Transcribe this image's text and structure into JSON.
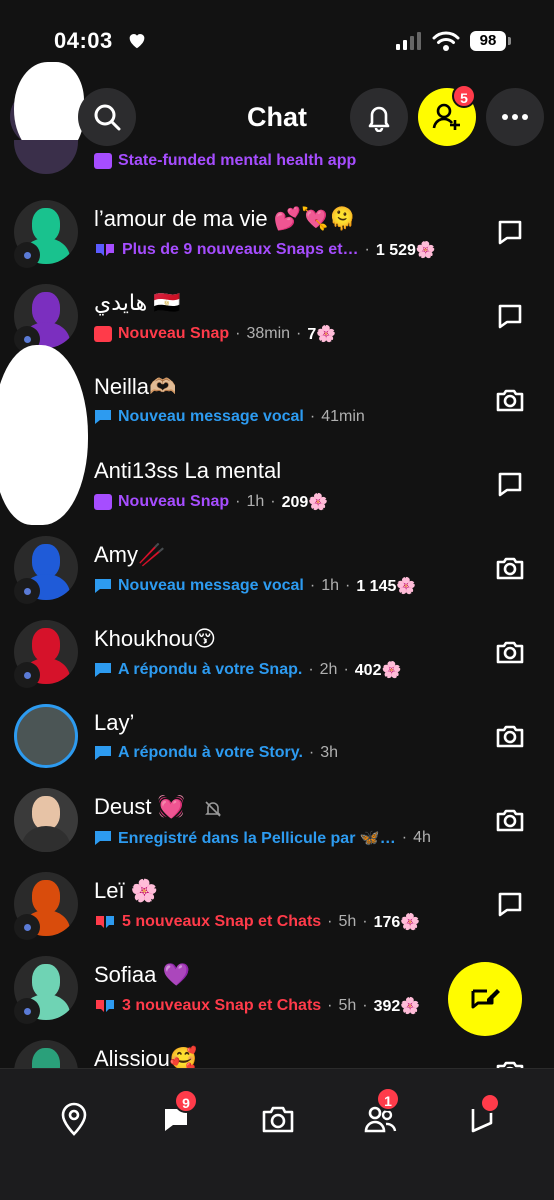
{
  "status": {
    "time": "04:03",
    "battery": "98"
  },
  "header": {
    "title": "Chat",
    "friend_badge": "5"
  },
  "chats": [
    {
      "name": "",
      "preview": "State-funded mental health app",
      "preview_color": "#a64dff",
      "meta": "",
      "streak": "",
      "action": "none",
      "avatar_color": "#5b3aa0"
    },
    {
      "name": "l’amour de ma vie 💕💘🫠",
      "preview": "Plus de 9 nouveaux Snaps et…",
      "preview_color": "#a64dff",
      "meta": "",
      "streak": "1 529🌸",
      "action": "chat",
      "avatar_color": "#19c28e"
    },
    {
      "name": "هايدي 🇪🇬",
      "preview": "Nouveau Snap",
      "preview_color": "#ff3b4a",
      "meta": "38min",
      "streak": "7🌸",
      "action": "chat",
      "avatar_color": "#7b2fbf"
    },
    {
      "name": "Neilla🫶🏼",
      "preview": "Nouveau message vocal",
      "preview_color": "#2d9bf0",
      "meta": "41min",
      "streak": "",
      "action": "camera",
      "avatar_color": "#444444"
    },
    {
      "name": "Anti13ss La mental",
      "preview": "Nouveau Snap",
      "preview_color": "#a64dff",
      "meta": "1h",
      "streak": "209🌸",
      "action": "chat",
      "avatar_color": "#444444"
    },
    {
      "name": "Amy🥢",
      "preview": "Nouveau message vocal",
      "preview_color": "#2d9bf0",
      "meta": "1h",
      "streak": "1 145🌸",
      "action": "camera",
      "avatar_color": "#1f5bd8"
    },
    {
      "name": "Khoukhou😚",
      "preview": "A répondu à votre Snap.",
      "preview_color": "#2d9bf0",
      "meta": "2h",
      "streak": "402🌸",
      "action": "camera",
      "avatar_color": "#d6122a"
    },
    {
      "name": "Lay’",
      "preview": "A répondu à votre Story.",
      "preview_color": "#2d9bf0",
      "meta": "3h",
      "streak": "",
      "action": "camera",
      "avatar_color": "#5a6a6a"
    },
    {
      "name": "Deust 💓",
      "preview": "Enregistré dans la Pellicule par 🦋…",
      "preview_color": "#2d9bf0",
      "meta": "4h",
      "streak": "",
      "action": "camera",
      "avatar_color": "#8a6a55"
    },
    {
      "name": "Leï 🌸",
      "preview": "5 nouveaux Snap et Chats",
      "preview_color": "#ff3b4a",
      "meta": "5h",
      "streak": "176🌸",
      "action": "chat",
      "avatar_color": "#d94c0c"
    },
    {
      "name": "Sofiaa 💜",
      "preview": "3 nouveaux Snap et Chats",
      "preview_color": "#ff3b4a",
      "meta": "5h",
      "streak": "392🌸",
      "action": "chat",
      "avatar_color": "#6fd3b4"
    },
    {
      "name": "Alissiou🥰",
      "preview": "",
      "preview_color": "#2d9bf0",
      "meta": "",
      "streak": "",
      "action": "camera",
      "avatar_color": "#2aa07a"
    }
  ],
  "nav": {
    "chat_badge": "9",
    "friends_badge": "1"
  },
  "colors": {
    "yellow": "#fffc00",
    "red": "#ff3b4a",
    "blue": "#2d9bf0",
    "purple": "#a64dff"
  }
}
